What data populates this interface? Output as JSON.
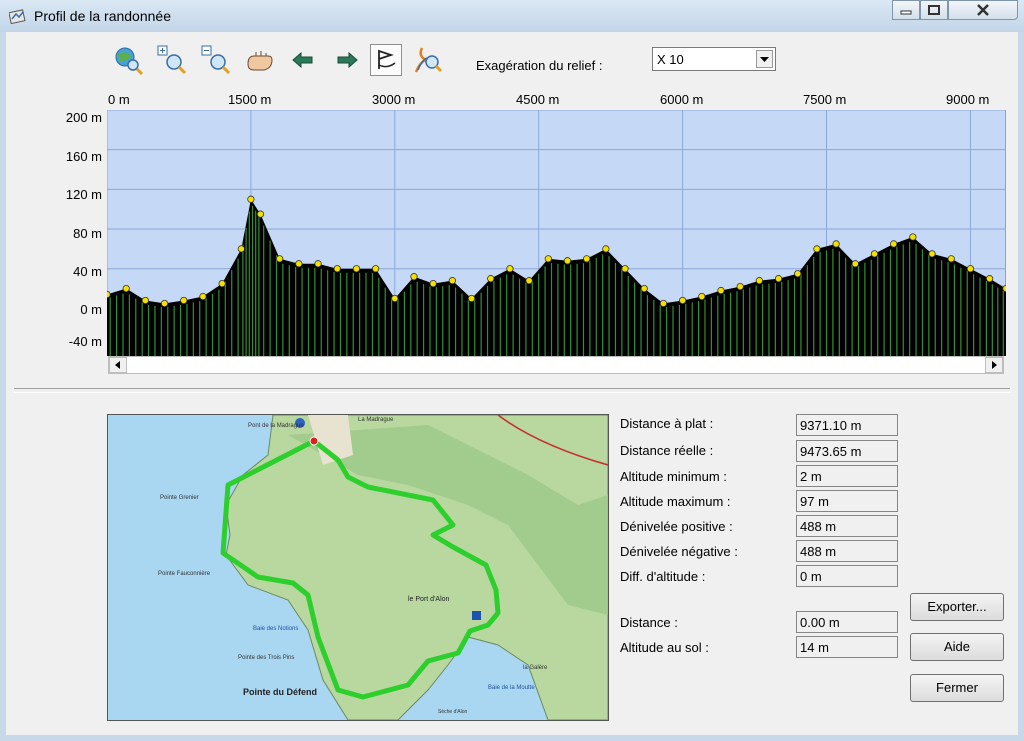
{
  "window": {
    "title": "Profil de la randonnée"
  },
  "toolbar": {
    "relief_label": "Exagération du relief :",
    "relief_value": "X 10"
  },
  "axes": {
    "x_ticks": [
      "0 m",
      "1500 m",
      "3000 m",
      "4500 m",
      "6000 m",
      "7500 m",
      "9000 m"
    ],
    "y_ticks": [
      "200 m",
      "160 m",
      "120 m",
      "80 m",
      "40 m",
      "0 m",
      "-40 m"
    ]
  },
  "chart_data": {
    "type": "area",
    "x": [
      0,
      200,
      400,
      600,
      800,
      1000,
      1200,
      1400,
      1500,
      1600,
      1800,
      2000,
      2200,
      2400,
      2600,
      2800,
      3000,
      3200,
      3400,
      3600,
      3800,
      4000,
      4200,
      4400,
      4600,
      4800,
      5000,
      5200,
      5400,
      5600,
      5800,
      6000,
      6200,
      6400,
      6600,
      6800,
      7000,
      7200,
      7400,
      7600,
      7800,
      8000,
      8200,
      8400,
      8600,
      8800,
      9000,
      9200,
      9371
    ],
    "y": [
      14,
      20,
      8,
      5,
      8,
      12,
      25,
      60,
      110,
      95,
      50,
      45,
      45,
      40,
      40,
      40,
      10,
      32,
      25,
      28,
      10,
      30,
      40,
      28,
      50,
      48,
      50,
      60,
      40,
      20,
      5,
      8,
      12,
      18,
      22,
      28,
      30,
      35,
      60,
      65,
      45,
      55,
      65,
      72,
      55,
      50,
      40,
      30,
      20
    ],
    "xlim": [
      0,
      9371
    ],
    "ylim": [
      -48,
      200
    ],
    "xlabel": "",
    "ylabel": "",
    "grid": true
  },
  "stats": [
    {
      "label": "Distance à plat :",
      "value": "9371.10 m"
    },
    {
      "label": "Distance réelle :",
      "value": "9473.65 m"
    },
    {
      "label": "Altitude minimum :",
      "value": "2 m"
    },
    {
      "label": "Altitude maximum :",
      "value": "97 m"
    },
    {
      "label": "Dénivelée positive :",
      "value": "488 m"
    },
    {
      "label": "Dénivelée négative :",
      "value": "488 m"
    },
    {
      "label": "Diff. d'altitude :",
      "value": "0 m"
    }
  ],
  "cursor": [
    {
      "label": "Distance :",
      "value": "0.00 m"
    },
    {
      "label": "Altitude au sol :",
      "value": "14 m"
    }
  ],
  "buttons": {
    "export": "Exporter...",
    "help": "Aide",
    "close": "Fermer"
  },
  "map_labels": {
    "north_village": "La Madrague",
    "point_grenier": "Pointe Grenier",
    "point_fauconniere": "Pointe Fauconnière",
    "bay_notions": "Baie des Notions",
    "point_trois_pins": "Pointe des Trois Pins",
    "point_defend": "Pointe du Défend",
    "port_alon": "le Port d'Alon",
    "moutte": "Baie de la Moutte",
    "galere": "la Galère",
    "cap_alon": "Sèche d'Alon",
    "moulin": "Pont de la Madrague"
  }
}
